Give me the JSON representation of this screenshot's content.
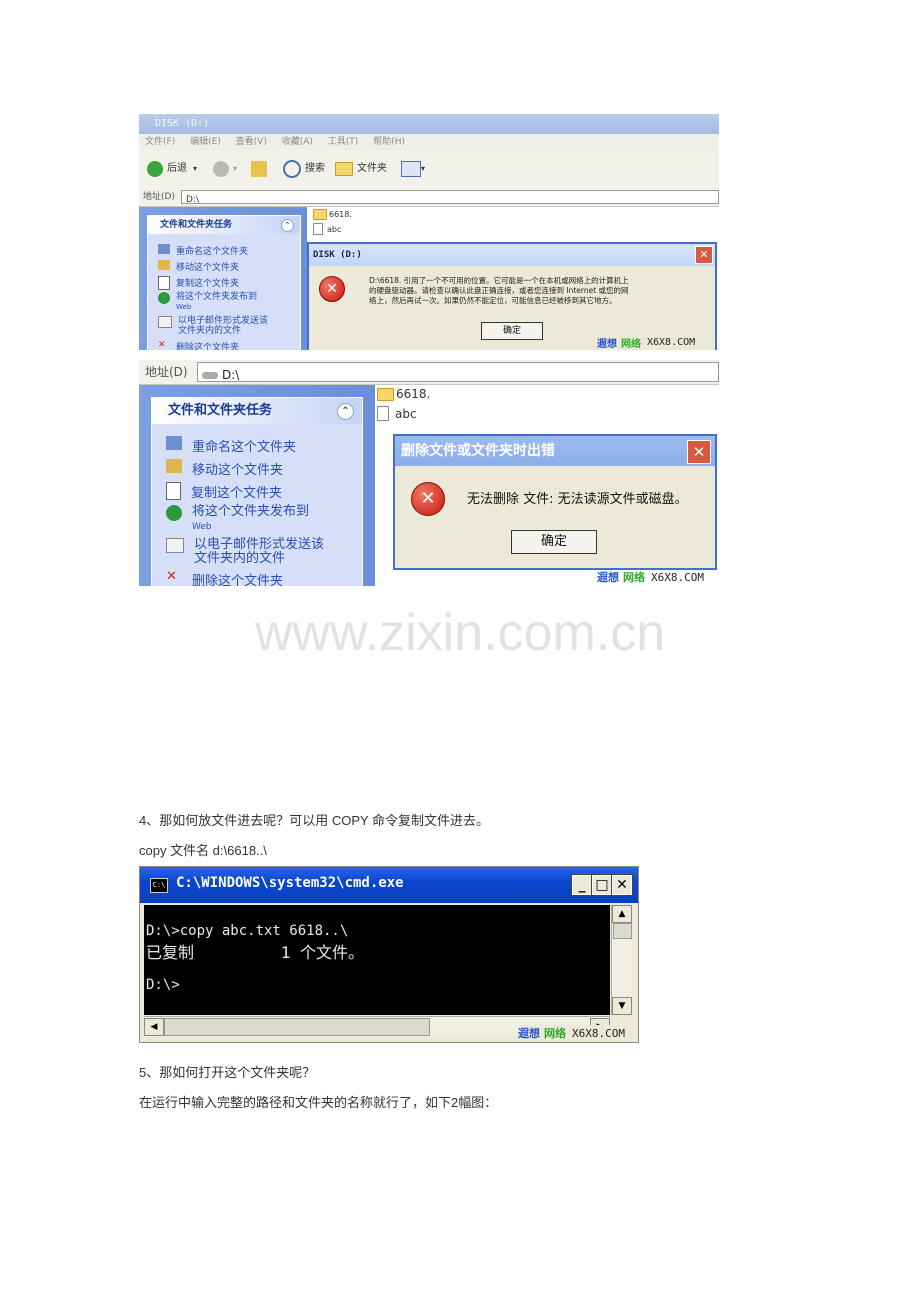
{
  "explorer1": {
    "title": "DISK (D:)",
    "menu": [
      "文件(F)",
      "编辑(E)",
      "查看(V)",
      "收藏(A)",
      "工具(T)",
      "帮助(H)"
    ],
    "toolbar": {
      "back": "后退",
      "search": "搜索",
      "folders": "文件夹"
    },
    "address_label": "地址(D)",
    "address_value": "D:\\",
    "task_header": "文件和文件夹任务",
    "tasks": [
      "重命名这个文件夹",
      "移动这个文件夹",
      "复制这个文件夹",
      "将这个文件夹发布到",
      "Web",
      "以电子邮件形式发送该",
      "文件夹内的文件",
      "删除这个文件夹"
    ],
    "files": [
      "6618.",
      "abc"
    ],
    "dialog": {
      "title": "DISK (D:)",
      "message_line1": "D:\\6618. 引用了一个不可用的位置。它可能是一个在本机或网络上的计算机上",
      "message_line2": "的硬盘驱动器。请检查以确认此盘正确连接，或者您连接到 Internet 或您的网",
      "message_line3": "络上，然后再试一次。如果仍然不能定位，可能信息已经被移到其它地方。",
      "ok": "确定"
    },
    "watermark": {
      "cn1": "遐想",
      "cn2": "网络",
      "en": "X6X8.COM"
    }
  },
  "explorer2": {
    "address_label": "地址(D)",
    "address_value": "D:\\",
    "task_header": "文件和文件夹任务",
    "tasks": [
      "重命名这个文件夹",
      "移动这个文件夹",
      "复制这个文件夹",
      "将这个文件夹发布到",
      "Web",
      "以电子邮件形式发送该",
      "文件夹内的文件",
      "删除这个文件夹"
    ],
    "files": [
      "6618.",
      "abc"
    ],
    "dialog": {
      "title": "删除文件或文件夹时出错",
      "message": "无法删除 文件: 无法读源文件或磁盘。",
      "ok": "确定"
    },
    "watermark": {
      "cn1": "遐想",
      "cn2": "网络",
      "en": "X6X8.COM"
    }
  },
  "site_watermark": "www.zixin.com.cn",
  "text": {
    "step4": "4、那如何放文件进去呢？可以用 COPY 命令复制文件进去。",
    "copy_cmd": "copy  文件名  d:\\6618..\\",
    "step5": "5、那如何打开这个文件夹呢？",
    "run_hint": "在运行中输入完整的路径和文件夹的名称就行了，如下2幅图："
  },
  "cmd": {
    "title": "C:\\WINDOWS\\system32\\cmd.exe",
    "icon_text": "C:\\",
    "lines": [
      "D:\\>copy abc.txt 6618..\\",
      "已复制         1 个文件。",
      "",
      "D:\\>"
    ],
    "watermark": {
      "cn1": "遐想",
      "cn2": "网络",
      "en": "X6X8.COM"
    }
  }
}
